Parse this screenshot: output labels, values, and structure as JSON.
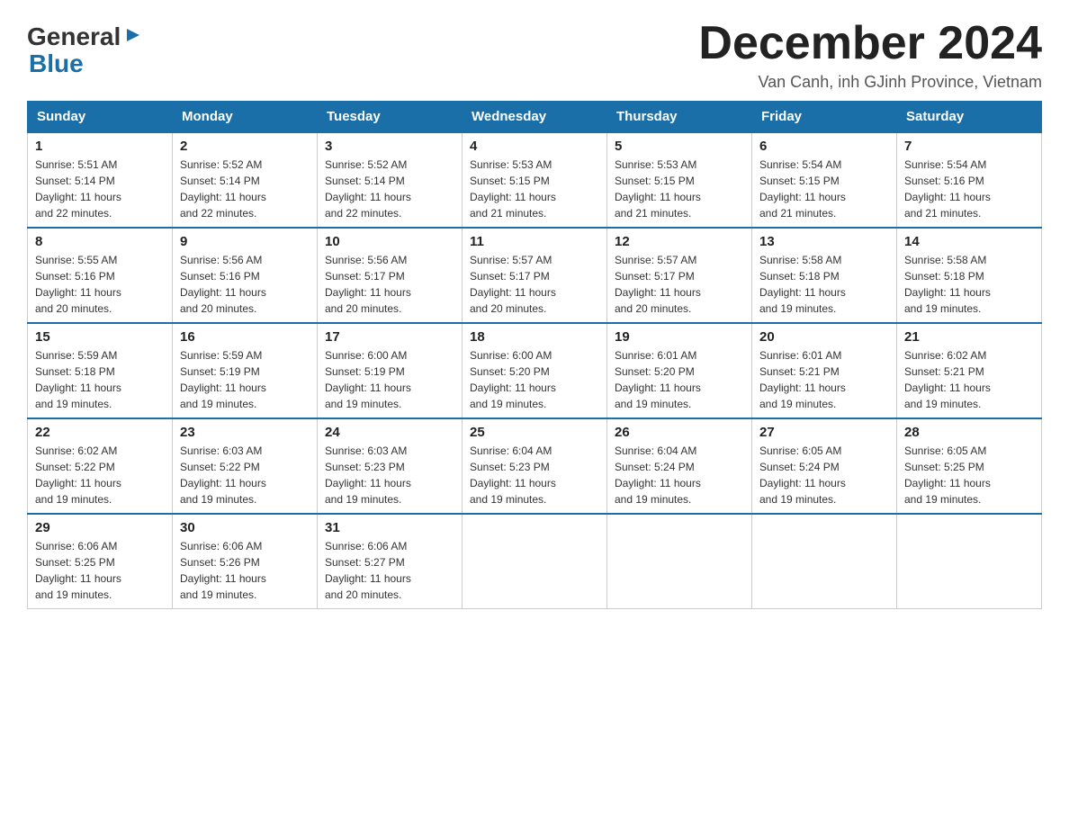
{
  "header": {
    "logo_general": "General",
    "logo_blue": "Blue",
    "month_title": "December 2024",
    "location": "Van Canh, inh GJinh Province, Vietnam"
  },
  "days_of_week": [
    "Sunday",
    "Monday",
    "Tuesday",
    "Wednesday",
    "Thursday",
    "Friday",
    "Saturday"
  ],
  "weeks": [
    [
      {
        "day": "1",
        "sunrise": "5:51 AM",
        "sunset": "5:14 PM",
        "daylight": "11 hours and 22 minutes."
      },
      {
        "day": "2",
        "sunrise": "5:52 AM",
        "sunset": "5:14 PM",
        "daylight": "11 hours and 22 minutes."
      },
      {
        "day": "3",
        "sunrise": "5:52 AM",
        "sunset": "5:14 PM",
        "daylight": "11 hours and 22 minutes."
      },
      {
        "day": "4",
        "sunrise": "5:53 AM",
        "sunset": "5:15 PM",
        "daylight": "11 hours and 21 minutes."
      },
      {
        "day": "5",
        "sunrise": "5:53 AM",
        "sunset": "5:15 PM",
        "daylight": "11 hours and 21 minutes."
      },
      {
        "day": "6",
        "sunrise": "5:54 AM",
        "sunset": "5:15 PM",
        "daylight": "11 hours and 21 minutes."
      },
      {
        "day": "7",
        "sunrise": "5:54 AM",
        "sunset": "5:16 PM",
        "daylight": "11 hours and 21 minutes."
      }
    ],
    [
      {
        "day": "8",
        "sunrise": "5:55 AM",
        "sunset": "5:16 PM",
        "daylight": "11 hours and 20 minutes."
      },
      {
        "day": "9",
        "sunrise": "5:56 AM",
        "sunset": "5:16 PM",
        "daylight": "11 hours and 20 minutes."
      },
      {
        "day": "10",
        "sunrise": "5:56 AM",
        "sunset": "5:17 PM",
        "daylight": "11 hours and 20 minutes."
      },
      {
        "day": "11",
        "sunrise": "5:57 AM",
        "sunset": "5:17 PM",
        "daylight": "11 hours and 20 minutes."
      },
      {
        "day": "12",
        "sunrise": "5:57 AM",
        "sunset": "5:17 PM",
        "daylight": "11 hours and 20 minutes."
      },
      {
        "day": "13",
        "sunrise": "5:58 AM",
        "sunset": "5:18 PM",
        "daylight": "11 hours and 19 minutes."
      },
      {
        "day": "14",
        "sunrise": "5:58 AM",
        "sunset": "5:18 PM",
        "daylight": "11 hours and 19 minutes."
      }
    ],
    [
      {
        "day": "15",
        "sunrise": "5:59 AM",
        "sunset": "5:18 PM",
        "daylight": "11 hours and 19 minutes."
      },
      {
        "day": "16",
        "sunrise": "5:59 AM",
        "sunset": "5:19 PM",
        "daylight": "11 hours and 19 minutes."
      },
      {
        "day": "17",
        "sunrise": "6:00 AM",
        "sunset": "5:19 PM",
        "daylight": "11 hours and 19 minutes."
      },
      {
        "day": "18",
        "sunrise": "6:00 AM",
        "sunset": "5:20 PM",
        "daylight": "11 hours and 19 minutes."
      },
      {
        "day": "19",
        "sunrise": "6:01 AM",
        "sunset": "5:20 PM",
        "daylight": "11 hours and 19 minutes."
      },
      {
        "day": "20",
        "sunrise": "6:01 AM",
        "sunset": "5:21 PM",
        "daylight": "11 hours and 19 minutes."
      },
      {
        "day": "21",
        "sunrise": "6:02 AM",
        "sunset": "5:21 PM",
        "daylight": "11 hours and 19 minutes."
      }
    ],
    [
      {
        "day": "22",
        "sunrise": "6:02 AM",
        "sunset": "5:22 PM",
        "daylight": "11 hours and 19 minutes."
      },
      {
        "day": "23",
        "sunrise": "6:03 AM",
        "sunset": "5:22 PM",
        "daylight": "11 hours and 19 minutes."
      },
      {
        "day": "24",
        "sunrise": "6:03 AM",
        "sunset": "5:23 PM",
        "daylight": "11 hours and 19 minutes."
      },
      {
        "day": "25",
        "sunrise": "6:04 AM",
        "sunset": "5:23 PM",
        "daylight": "11 hours and 19 minutes."
      },
      {
        "day": "26",
        "sunrise": "6:04 AM",
        "sunset": "5:24 PM",
        "daylight": "11 hours and 19 minutes."
      },
      {
        "day": "27",
        "sunrise": "6:05 AM",
        "sunset": "5:24 PM",
        "daylight": "11 hours and 19 minutes."
      },
      {
        "day": "28",
        "sunrise": "6:05 AM",
        "sunset": "5:25 PM",
        "daylight": "11 hours and 19 minutes."
      }
    ],
    [
      {
        "day": "29",
        "sunrise": "6:06 AM",
        "sunset": "5:25 PM",
        "daylight": "11 hours and 19 minutes."
      },
      {
        "day": "30",
        "sunrise": "6:06 AM",
        "sunset": "5:26 PM",
        "daylight": "11 hours and 19 minutes."
      },
      {
        "day": "31",
        "sunrise": "6:06 AM",
        "sunset": "5:27 PM",
        "daylight": "11 hours and 20 minutes."
      },
      null,
      null,
      null,
      null
    ]
  ],
  "labels": {
    "sunrise": "Sunrise:",
    "sunset": "Sunset:",
    "daylight": "Daylight:"
  },
  "colors": {
    "header_bg": "#1a6fa8",
    "header_text": "#ffffff",
    "border": "#1a6fa8"
  }
}
